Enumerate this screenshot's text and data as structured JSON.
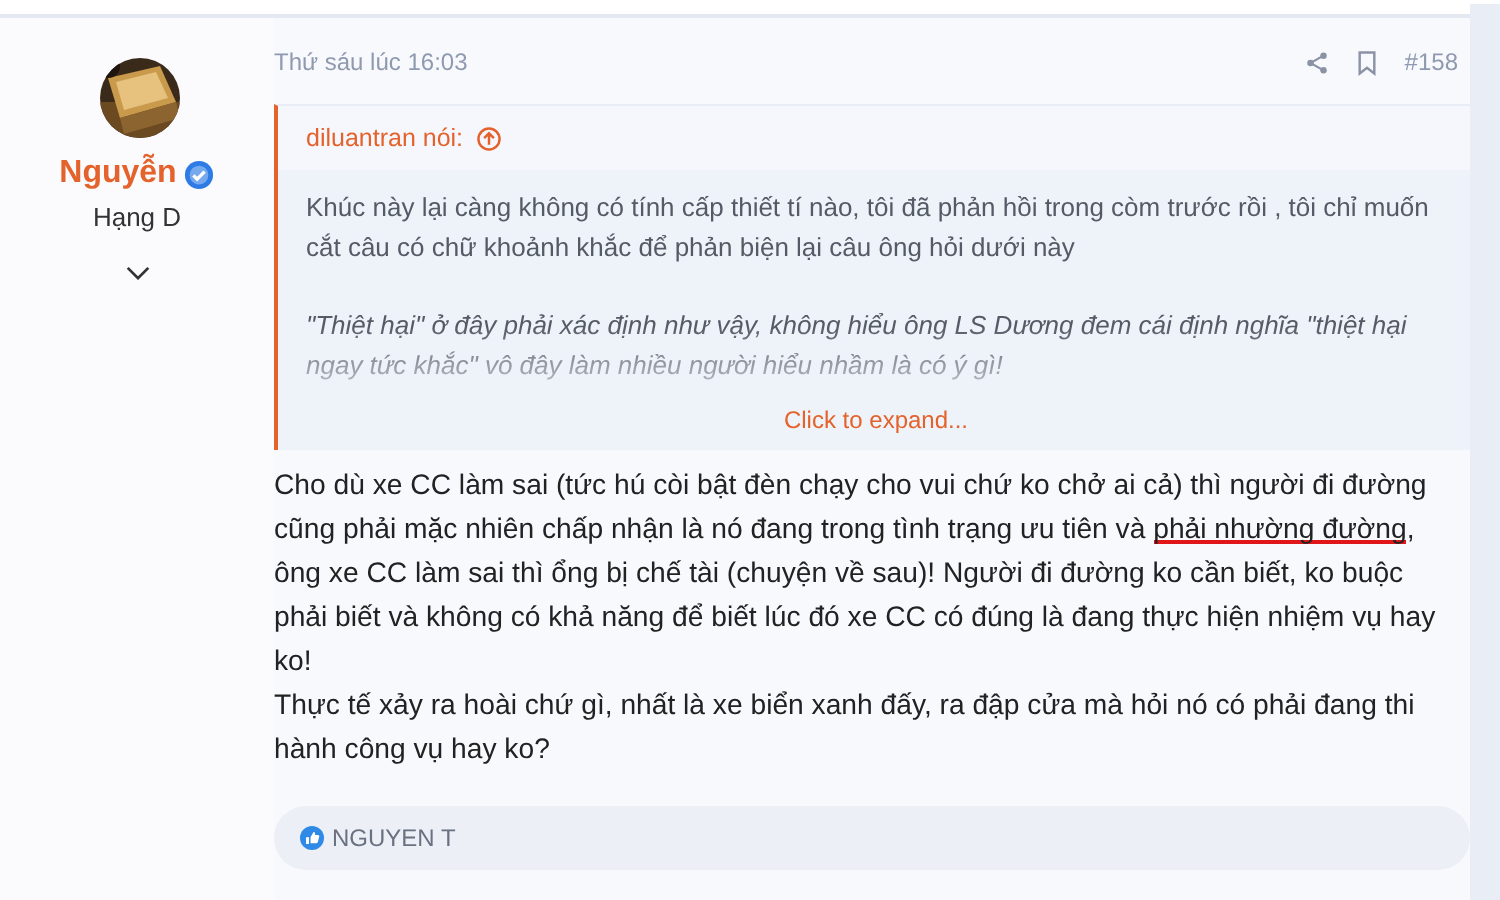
{
  "author": {
    "name": "Nguyễn",
    "verified": true,
    "rank": "Hạng D"
  },
  "post": {
    "time": "Thứ sáu lúc 16:03",
    "number": "#158",
    "quote": {
      "author": "diluantran nói:",
      "paragraphs": [
        {
          "text": "Khúc này lại càng không có tính cấp thiết tí nào, tôi đã phản hồi trong còm trước rồi , tôi chỉ muốn cắt câu có chữ khoảnh khắc để phản biện lại câu ông hỏi dưới này",
          "italic": false
        },
        {
          "text": "\"Thiệt hại\" ở đây phải xác định như vậy, không hiểu ông LS Dương đem cái định nghĩa \"thiệt hại ngay tức khắc\" vô đây làm nhiều người hiểu nhầm là có ý gì!",
          "italic": true
        }
      ],
      "expand": "Click to expand..."
    },
    "body": [
      {
        "segments": [
          {
            "text": "Cho dù xe CC làm sai (tức hú còi bật đèn chạy cho vui chứ ko chở ai cả) thì người đi đường cũng phải mặc nhiên chấp nhận là nó đang trong tình trạng ưu tiên và ",
            "marked": false
          },
          {
            "text": "phải nhường đường",
            "marked": true
          },
          {
            "text": ", ông xe CC làm sai thì ổng bị chế tài (chuyện về sau)! Người đi đường ko cần biết, ko buộc phải biết và không có khả năng để biết lúc đó xe CC có đúng là đang thực hiện nhiệm vụ hay ko!",
            "marked": false
          }
        ]
      },
      {
        "segments": [
          {
            "text": "Thực tế xảy ra hoài chứ gì, nhất là xe biển xanh đấy, ra đập cửa mà hỏi nó có phải đang thi hành công vụ hay ko?",
            "marked": false
          }
        ]
      }
    ],
    "reactions": {
      "users": "NGUYEN T"
    }
  }
}
